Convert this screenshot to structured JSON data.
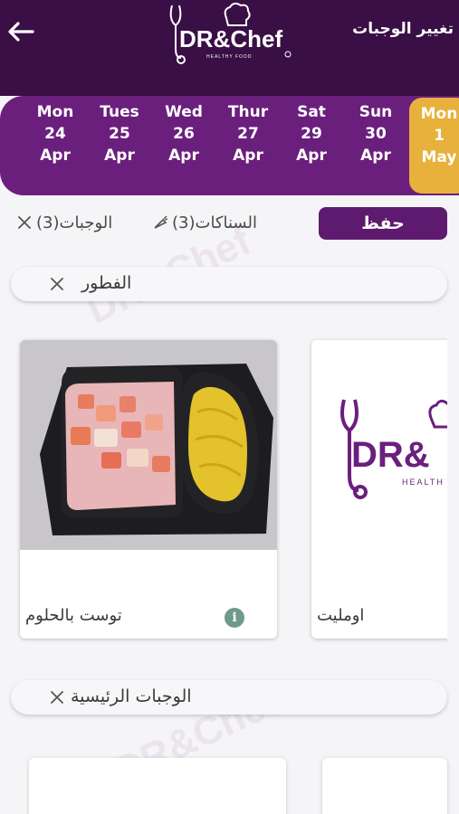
{
  "header": {
    "title": "تغيير الوجبات",
    "brand": "DR&Chef",
    "brand_tagline": "HEALTHY FOOD",
    "background_color": "#3a0f45"
  },
  "dates": [
    {
      "day": "Mon",
      "date": "24",
      "month": "Apr",
      "selected": false
    },
    {
      "day": "Tues",
      "date": "25",
      "month": "Apr",
      "selected": false
    },
    {
      "day": "Wed",
      "date": "26",
      "month": "Apr",
      "selected": false
    },
    {
      "day": "Thur",
      "date": "27",
      "month": "Apr",
      "selected": false
    },
    {
      "day": "Sat",
      "date": "29",
      "month": "Apr",
      "selected": false
    },
    {
      "day": "Sun",
      "date": "30",
      "month": "Apr",
      "selected": false
    },
    {
      "day": "Mon",
      "date": "1",
      "month": "May",
      "selected": true
    }
  ],
  "tabs": {
    "save_label": "حفظ",
    "snacks_label": "السناكات(3)",
    "meals_label": "الوجبات(3)"
  },
  "sections": {
    "breakfast": "الفطور",
    "main_meals": "الوجبات الرئيسية"
  },
  "meals": [
    {
      "name": "توست بالحلوم",
      "icon": "info-icon"
    },
    {
      "name": "اومليت",
      "icon": "brand-logo"
    }
  ],
  "colors": {
    "purple_dark": "#3a0f45",
    "purple_strip": "#6b1f7d",
    "selected_date": "#e7b13c",
    "save_button": "#5e1a6e"
  }
}
